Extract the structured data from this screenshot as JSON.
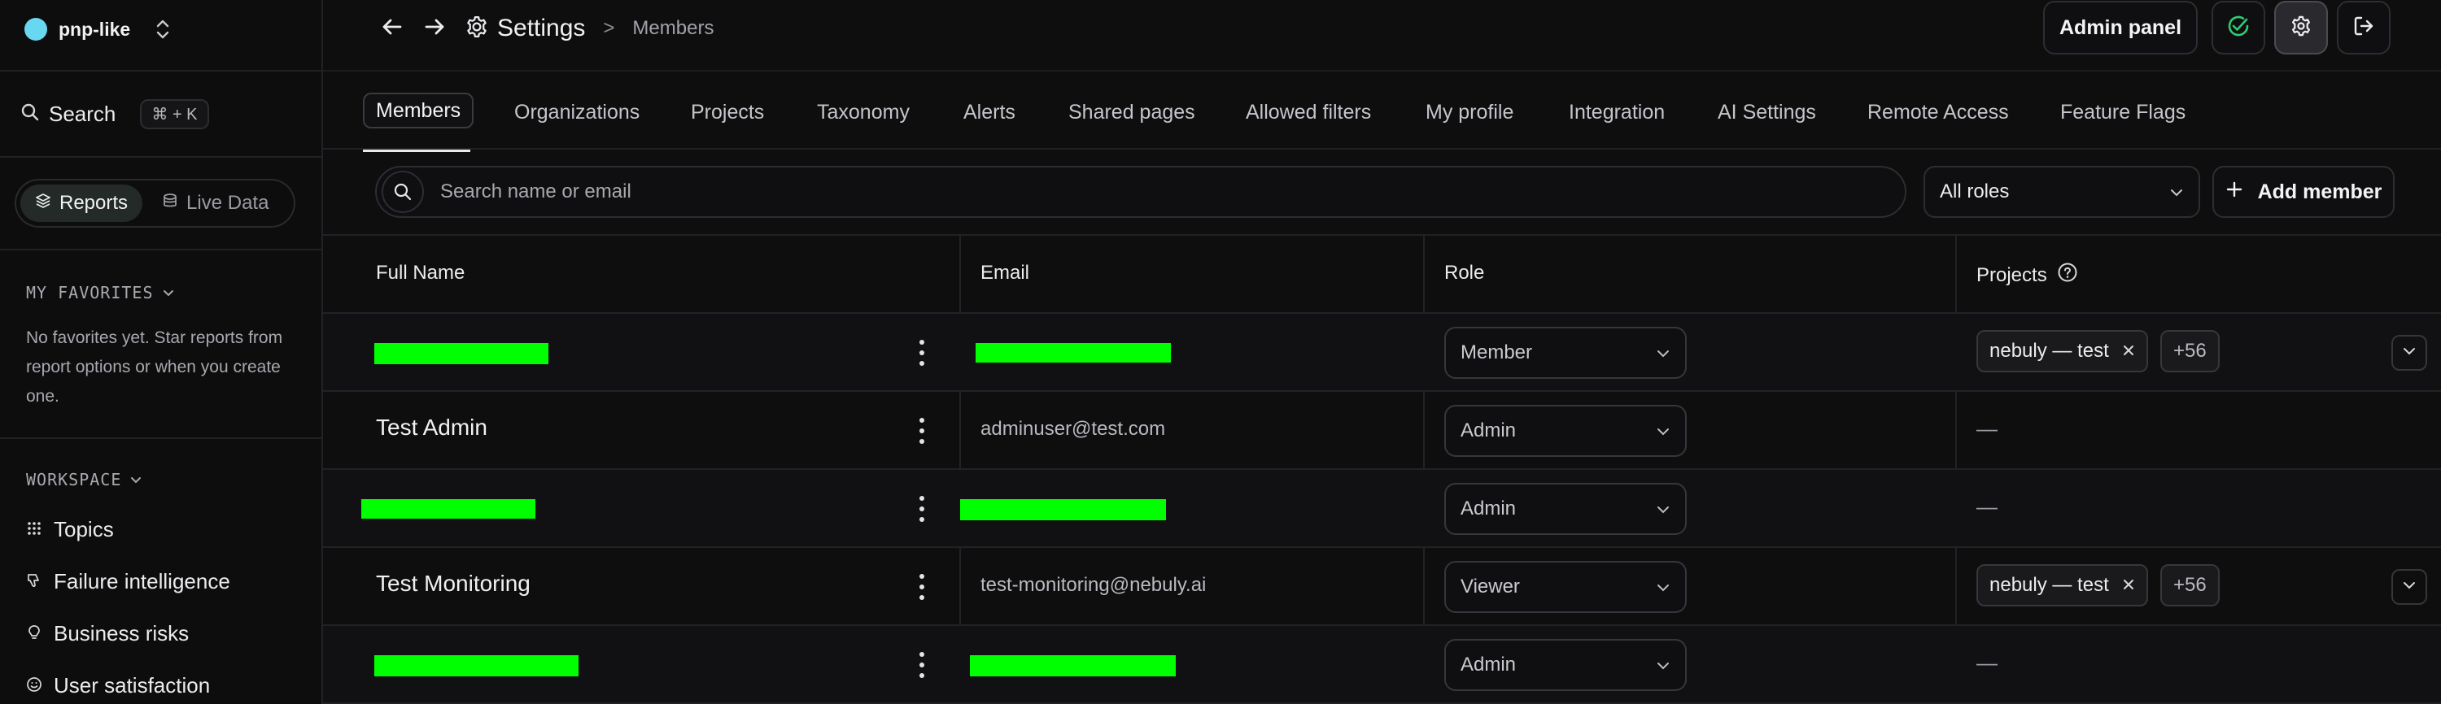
{
  "workspace": {
    "name": "pnp-like",
    "dot_color": "#67d8ef"
  },
  "sidebar": {
    "search_label": "Search",
    "search_shortcut": "⌘ + K",
    "segment": [
      {
        "label": "Reports",
        "icon": "layers-icon",
        "active": true
      },
      {
        "label": "Live Data",
        "icon": "database-icon",
        "active": false
      }
    ],
    "favorites_title": "MY FAVORITES",
    "favorites_empty": "No favorites yet. Star reports from report options or when you create one.",
    "workspace_title": "WORKSPACE",
    "nav": [
      {
        "label": "Topics",
        "icon": "grid-icon"
      },
      {
        "label": "Failure intelligence",
        "icon": "thumbs-down-icon"
      },
      {
        "label": "Business risks",
        "icon": "lightbulb-icon"
      },
      {
        "label": "User satisfaction",
        "icon": "smile-icon"
      }
    ]
  },
  "header": {
    "title": "Settings",
    "separator": ">",
    "subtitle": "Members",
    "admin_panel": "Admin panel",
    "status_color": "#2ecc71"
  },
  "tabs": [
    "Members",
    "Organizations",
    "Projects",
    "Taxonomy",
    "Alerts",
    "Shared pages",
    "Allowed filters",
    "My profile",
    "Integration",
    "AI Settings",
    "Remote Access",
    "Feature Flags"
  ],
  "filters": {
    "search_placeholder": "Search name or email",
    "roles_value": "All roles",
    "add_member": "Add member"
  },
  "table": {
    "columns": {
      "name": "Full Name",
      "email": "Email",
      "role": "Role",
      "projects": "Projects"
    },
    "rows": [
      {
        "name": "",
        "email": "",
        "role": "Member",
        "project_chip": "nebuly — test",
        "project_more": "+56",
        "redacted": true
      },
      {
        "name": "Test Admin",
        "email": "adminuser@test.com",
        "role": "Admin",
        "projects_empty": "—",
        "redacted": false
      },
      {
        "name": "",
        "email": "",
        "role": "Admin",
        "projects_empty": "—",
        "redacted": true
      },
      {
        "name": "Test Monitoring",
        "email": "test-monitoring@nebuly.ai",
        "role": "Viewer",
        "project_chip": "nebuly — test",
        "project_more": "+56",
        "redacted": false
      },
      {
        "name": "",
        "email": "",
        "role": "Admin",
        "projects_empty": "—",
        "redacted": true
      }
    ]
  },
  "colors": {
    "redaction": "#00ff00",
    "background": "#0e0e0f"
  }
}
